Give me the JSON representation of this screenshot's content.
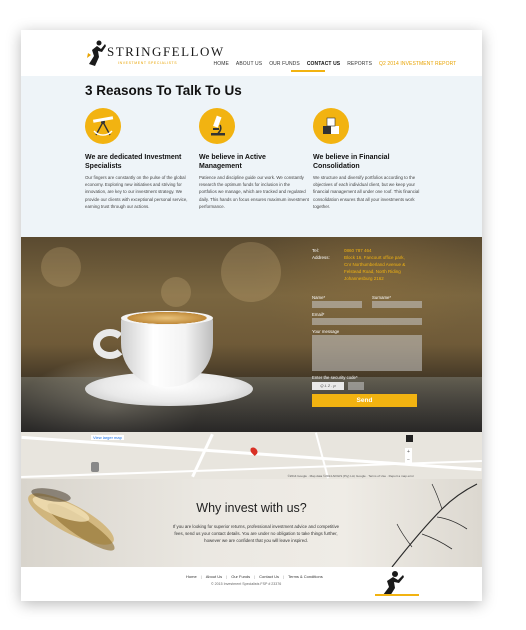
{
  "header": {
    "logo_text": "STRINGFELLOW",
    "logo_subtitle": "INVESTMENT SPECIALISTS",
    "nav": [
      {
        "label": "HOME"
      },
      {
        "label": "ABOUT US"
      },
      {
        "label": "OUR FUNDS"
      },
      {
        "label": "CONTACT US"
      },
      {
        "label": "REPORTS"
      },
      {
        "label": "Q2 2014 INVESTMENT REPORT"
      }
    ]
  },
  "reasons": {
    "title": "3 Reasons To Talk To Us",
    "columns": [
      {
        "icon": "compass-ruler-icon",
        "heading": "We are dedicated Investment Specialists",
        "text": "Our fingers are constantly on the pulse of the global economy. Exploring new initiatives and striving for innovation, are key to our investment strategy. We provide our clients with exceptional personal service, earning trust through our actions."
      },
      {
        "icon": "microscope-icon",
        "heading": "We believe in Active Management",
        "text": "Patience and discipline guide our work. We constantly research the optimum funds for inclusion in the portfolios we manage, which are tracked and regulated daily. This hands on focus ensures maximum investment performance."
      },
      {
        "icon": "cubes-icon",
        "heading": "We believe in Financial Consolidation",
        "text": "We structure and diversify portfolios according to the objectives of each individual client, but we keep your financial management all under one roof. This financial consolidation ensures that all your investments work together."
      }
    ]
  },
  "contact": {
    "tel_label": "Tel:",
    "tel_value": "0860 787 464",
    "address_label": "Address:",
    "address_lines": [
      "Block 16, Fancourt office park,",
      "Cnr Northumberland Avenue &",
      "Felstead Road, North Riding",
      "Johannesburg 2162"
    ],
    "form": {
      "name_label": "Name*",
      "surname_label": "Surname*",
      "email_label": "Email*",
      "message_label": "Your message",
      "security_label": "Enter the security code*",
      "captcha_text": "Q L 2 . p",
      "send_label": "Send"
    }
  },
  "map": {
    "larger_map_label": "View larger map",
    "footer_text": "©2014 Google · Map data ©2014 AfriGIS (Pty) Ltd, Google · Terms of Use · Report a map error"
  },
  "why": {
    "title": "Why invest with us?",
    "text": "If you are looking for superior returns, professional investment advice and competitive fees, send us your contact details. You are under no obligation to take things further, however we are confident that you will leave inspired."
  },
  "footer": {
    "links": [
      {
        "label": "Home"
      },
      {
        "label": "About Us"
      },
      {
        "label": "Our Funds"
      },
      {
        "label": "Contact Us"
      },
      {
        "label": "Terms & Conditions"
      }
    ],
    "copyright": "© 2015 Investment Specialists FSP # 23376"
  },
  "colors": {
    "accent": "#f2b311",
    "light_panel": "#eef4f8"
  }
}
